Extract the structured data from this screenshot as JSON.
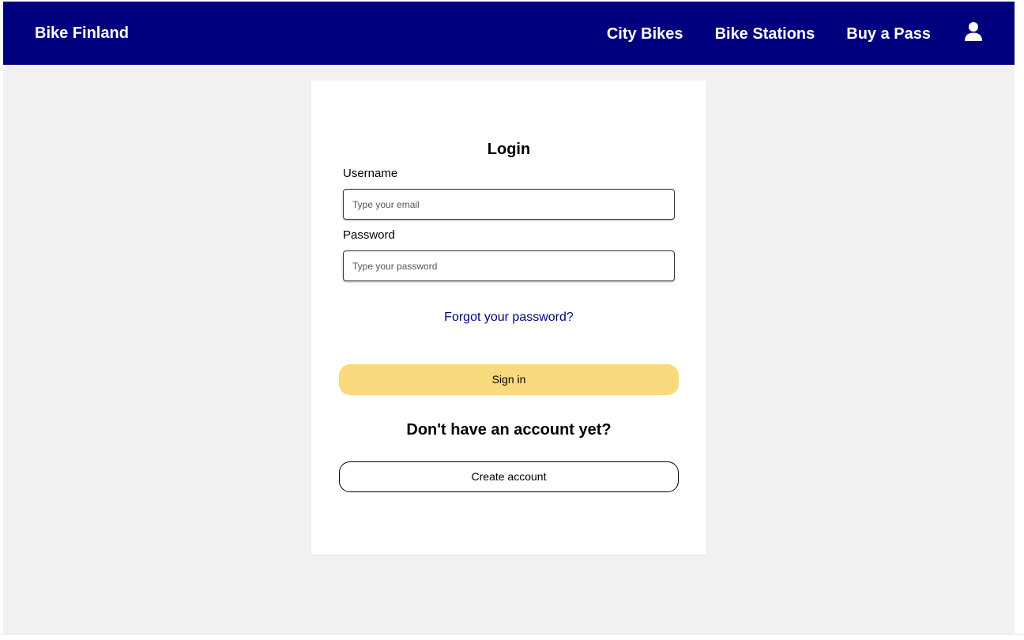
{
  "header": {
    "brand": "Bike Finland",
    "nav": [
      "City Bikes",
      "Bike Stations",
      "Buy a Pass"
    ],
    "user_icon": "user-icon",
    "background_color": "#00007f"
  },
  "login": {
    "title": "Login",
    "username_label": "Username",
    "username_placeholder": "Type your email",
    "username_value": "",
    "password_label": "Password",
    "password_placeholder": "Type your password",
    "password_value": "",
    "forgot_link": "Forgot your password?",
    "sign_in_button": "Sign in",
    "sign_in_color": "#f8d97b",
    "no_account_text": "Don't have an account yet?",
    "create_account_button": "Create account"
  }
}
